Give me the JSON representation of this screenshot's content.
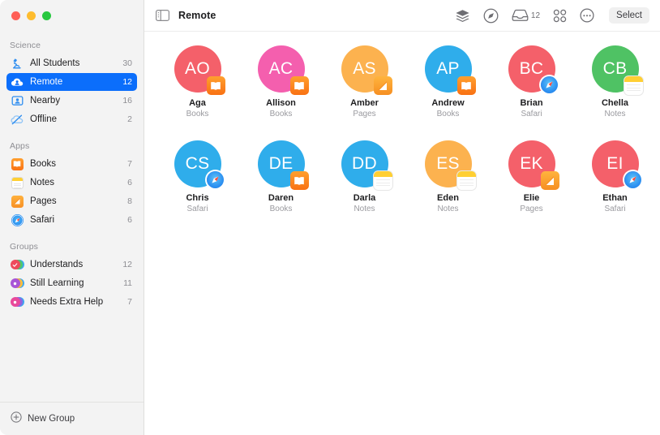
{
  "window": {
    "traffic_lights": [
      "close",
      "minimize",
      "zoom"
    ]
  },
  "sidebar": {
    "sections": [
      {
        "title": "Science",
        "items": [
          {
            "label": "All Students",
            "count": "30",
            "icon": "microscope-icon",
            "selected": false
          },
          {
            "label": "Remote",
            "count": "12",
            "icon": "cloud-person-icon",
            "selected": true
          },
          {
            "label": "Nearby",
            "count": "16",
            "icon": "person-frame-icon",
            "selected": false
          },
          {
            "label": "Offline",
            "count": "2",
            "icon": "cloud-slash-icon",
            "selected": false
          }
        ]
      },
      {
        "title": "Apps",
        "items": [
          {
            "label": "Books",
            "count": "7",
            "icon": "books-app-icon",
            "selected": false
          },
          {
            "label": "Notes",
            "count": "6",
            "icon": "notes-app-icon",
            "selected": false
          },
          {
            "label": "Pages",
            "count": "8",
            "icon": "pages-app-icon",
            "selected": false
          },
          {
            "label": "Safari",
            "count": "6",
            "icon": "safari-app-icon",
            "selected": false
          }
        ]
      },
      {
        "title": "Groups",
        "items": [
          {
            "label": "Understands",
            "count": "12",
            "icon": "group-icon",
            "selected": false,
            "color": "#ee4a5c"
          },
          {
            "label": "Still Learning",
            "count": "11",
            "icon": "group-icon",
            "selected": false,
            "color": "#a855d6"
          },
          {
            "label": "Needs Extra Help",
            "count": "7",
            "icon": "group-icon",
            "selected": false,
            "color": "#e8499b"
          }
        ]
      }
    ],
    "footer": {
      "new_group_label": "New Group",
      "new_group_icon": "plus-circle-icon"
    },
    "selection_color": "#0b6efb"
  },
  "toolbar": {
    "sidebar_toggle_icon": "sidebar-toggle-icon",
    "title": "Remote",
    "actions": [
      {
        "name": "layers-icon",
        "label": ""
      },
      {
        "name": "compass-icon",
        "label": ""
      },
      {
        "name": "inbox-icon",
        "label": "12"
      },
      {
        "name": "grid-apps-icon",
        "label": ""
      },
      {
        "name": "ellipsis-circle-icon",
        "label": ""
      }
    ],
    "inbox_count": "12",
    "select_label": "Select"
  },
  "students": [
    {
      "initials": "AO",
      "name": "Aga",
      "app": "Books",
      "color": "#f4606a",
      "badge": "books"
    },
    {
      "initials": "AC",
      "name": "Allison",
      "app": "Books",
      "color": "#f45fae",
      "badge": "books"
    },
    {
      "initials": "AS",
      "name": "Amber",
      "app": "Pages",
      "color": "#fcb24f",
      "badge": "pages"
    },
    {
      "initials": "AP",
      "name": "Andrew",
      "app": "Books",
      "color": "#2fadeb",
      "badge": "books"
    },
    {
      "initials": "BC",
      "name": "Brian",
      "app": "Safari",
      "color": "#f4606a",
      "badge": "safari"
    },
    {
      "initials": "CB",
      "name": "Chella",
      "app": "Notes",
      "color": "#4fc264",
      "badge": "notes"
    },
    {
      "initials": "CS",
      "name": "Chris",
      "app": "Safari",
      "color": "#2fadeb",
      "badge": "safari"
    },
    {
      "initials": "DE",
      "name": "Daren",
      "app": "Books",
      "color": "#2fadeb",
      "badge": "books"
    },
    {
      "initials": "DD",
      "name": "Darla",
      "app": "Notes",
      "color": "#2fadeb",
      "badge": "notes"
    },
    {
      "initials": "ES",
      "name": "Eden",
      "app": "Notes",
      "color": "#fcb24f",
      "badge": "notes"
    },
    {
      "initials": "EK",
      "name": "Elie",
      "app": "Pages",
      "color": "#f4606a",
      "badge": "pages"
    },
    {
      "initials": "EI",
      "name": "Ethan",
      "app": "Safari",
      "color": "#f4606a",
      "badge": "safari"
    }
  ]
}
